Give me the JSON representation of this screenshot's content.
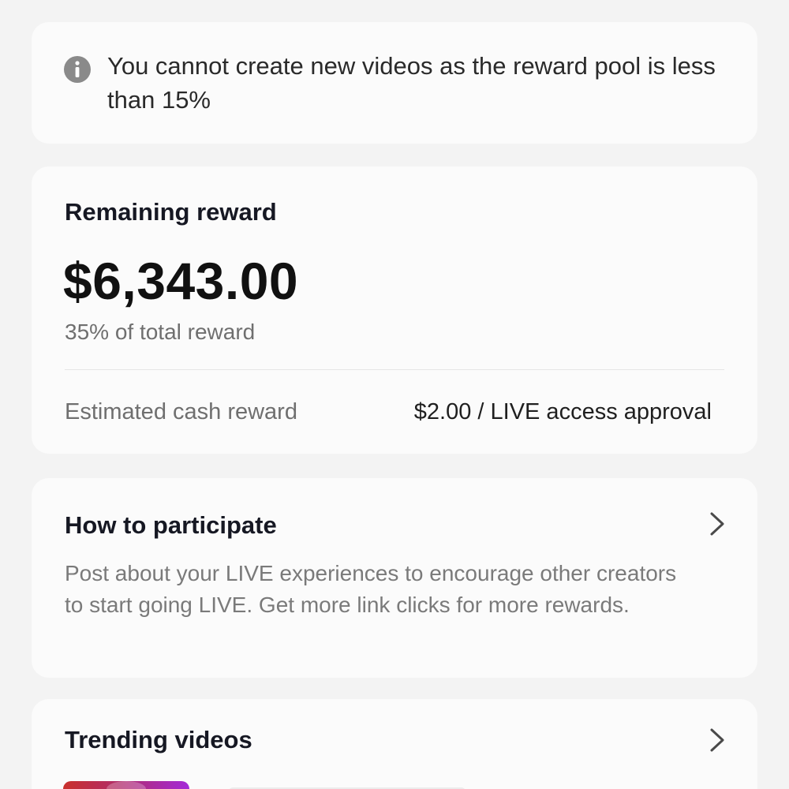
{
  "notice": {
    "icon": "info-icon",
    "text": "You cannot create new videos as the reward pool is less than 15%"
  },
  "reward": {
    "title": "Remaining reward",
    "amount": "$6,343.00",
    "percent_text": "35% of total reward",
    "percent_value": 35,
    "estimated_label": "Estimated cash reward",
    "estimated_value": "$2.00 / LIVE access approval"
  },
  "participate": {
    "title": "How to participate",
    "description": "Post about your LIVE experiences to encourage other creators to start going LIVE. Get more link clicks for more rewards.",
    "chevron_icon": "chevron-right-icon"
  },
  "trending": {
    "title": "Trending videos",
    "chevron_icon": "chevron-right-icon"
  },
  "colors": {
    "background": "#f3f3f3",
    "card": "#fbfbfb",
    "primary_text": "#161823",
    "secondary_text": "#6f6f6f"
  }
}
